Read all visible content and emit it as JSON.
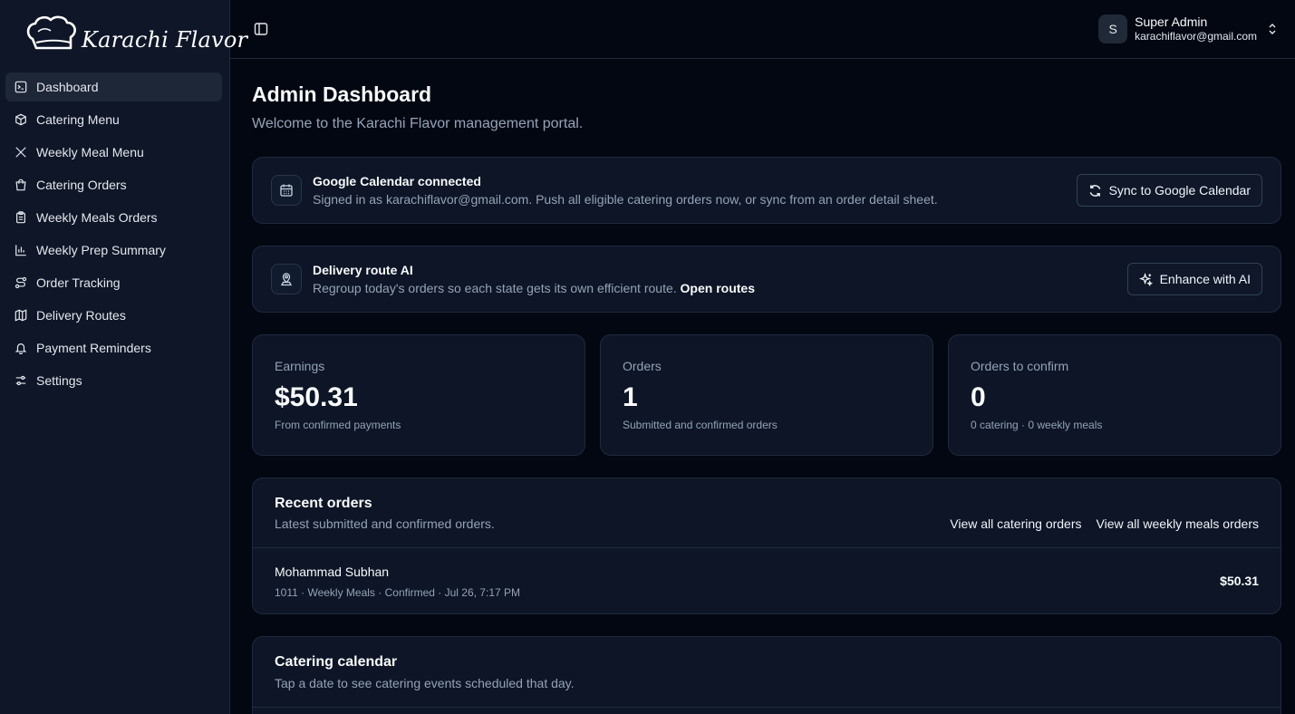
{
  "brand": {
    "name": "Karachi Flavor"
  },
  "sidebar": {
    "items": [
      {
        "label": "Dashboard",
        "icon": "dashboard-icon"
      },
      {
        "label": "Catering Menu",
        "icon": "box-icon"
      },
      {
        "label": "Weekly Meal Menu",
        "icon": "utensils-icon"
      },
      {
        "label": "Catering Orders",
        "icon": "shopping-bag-icon"
      },
      {
        "label": "Weekly Meals Orders",
        "icon": "clipboard-icon"
      },
      {
        "label": "Weekly Prep Summary",
        "icon": "bar-chart-icon"
      },
      {
        "label": "Order Tracking",
        "icon": "route-icon"
      },
      {
        "label": "Delivery Routes",
        "icon": "map-icon"
      },
      {
        "label": "Payment Reminders",
        "icon": "bell-icon"
      },
      {
        "label": "Settings",
        "icon": "settings-sliders-icon"
      }
    ],
    "active_index": 0
  },
  "header": {
    "user": {
      "avatar_initial": "S",
      "name": "Super Admin",
      "email": "karachiflavor@gmail.com"
    }
  },
  "page": {
    "title": "Admin Dashboard",
    "subtitle": "Welcome to the Karachi Flavor management portal."
  },
  "calendar_banner": {
    "title": "Google Calendar connected",
    "description": "Signed in as karachiflavor@gmail.com. Push all eligible catering orders now, or sync from an order detail sheet.",
    "button": "Sync to Google Calendar"
  },
  "route_banner": {
    "title": "Delivery route AI",
    "description": "Regroup today's orders so each state gets its own efficient route.",
    "link": "Open routes",
    "button": "Enhance with AI"
  },
  "stats": [
    {
      "label": "Earnings",
      "value": "$50.31",
      "note": "From confirmed payments"
    },
    {
      "label": "Orders",
      "value": "1",
      "note": "Submitted and confirmed orders"
    },
    {
      "label": "Orders to confirm",
      "value": "0",
      "note": "0 catering · 0 weekly meals"
    }
  ],
  "recent_orders": {
    "title": "Recent orders",
    "subtitle": "Latest submitted and confirmed orders.",
    "link_catering": "View all catering orders",
    "link_weekly": "View all weekly meals orders",
    "rows": [
      {
        "customer": "Mohammad Subhan",
        "meta": "1011 · Weekly Meals · Confirmed · Jul 26, 7:17 PM",
        "amount": "$50.31"
      }
    ]
  },
  "catering_calendar": {
    "title": "Catering calendar",
    "subtitle": "Tap a date to see catering events scheduled that day."
  },
  "colors": {
    "background": "#030712",
    "sidebar": "#0e1628",
    "card": "#0d1526",
    "border": "#1f2a3c",
    "muted_text": "#94a3b8"
  }
}
